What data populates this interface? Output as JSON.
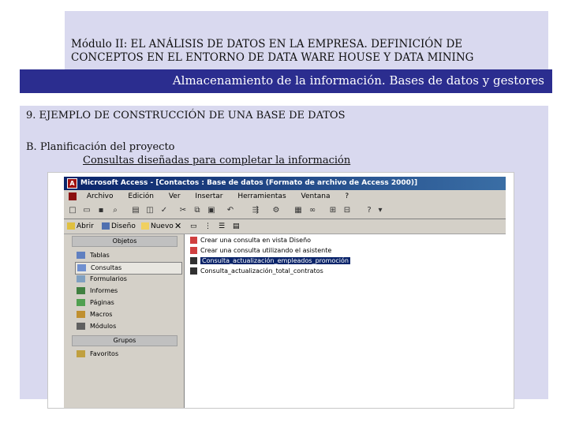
{
  "slide": {
    "header_line1": "Módulo II: EL ANÁLISIS DE DATOS EN LA EMPRESA. DEFINICIÓN DE",
    "header_line2": "CONCEPTOS EN EL ENTORNO DE DATA WARE HOUSE Y DATA MINING",
    "banner": "Almacenamiento de la información. Bases de datos y gestores",
    "section_title": "9. EJEMPLO DE CONSTRUCCIÓN DE UNA BASE DE DATOS",
    "sub_title": "B. Planificación del proyecto",
    "sub_sub_title": "Consultas diseñadas para completar la información",
    "colors": {
      "header_bg": "#d9d9ef",
      "banner_bg": "#2b2d8f",
      "banner_text": "#ffffff"
    }
  },
  "access": {
    "title": "Microsoft Access - [Contactos : Base de datos (Formato de archivo de Access 2000)]",
    "menu": [
      "Archivo",
      "Edición",
      "Ver",
      "Insertar",
      "Herramientas",
      "Ventana",
      "?"
    ],
    "db_toolbar": {
      "open": "Abrir",
      "design": "Diseño",
      "new": "Nuevo"
    },
    "objects_header": "Objetos",
    "objects": [
      {
        "label": "Tablas",
        "icon": "table-icon"
      },
      {
        "label": "Consultas",
        "icon": "query-icon",
        "selected": true
      },
      {
        "label": "Formularios",
        "icon": "form-icon"
      },
      {
        "label": "Informes",
        "icon": "report-icon"
      },
      {
        "label": "Páginas",
        "icon": "page-icon"
      },
      {
        "label": "Macros",
        "icon": "macro-icon"
      },
      {
        "label": "Módulos",
        "icon": "module-icon"
      }
    ],
    "groups_header": "Grupos",
    "groups": [
      {
        "label": "Favoritos",
        "icon": "favorites-icon"
      }
    ],
    "queries": [
      {
        "label": "Crear una consulta en vista Diseño",
        "icon": "wizard-icon"
      },
      {
        "label": "Crear una consulta utilizando el asistente",
        "icon": "wizard-icon"
      },
      {
        "label": "Consulta_actualización_empleados_promoción",
        "icon": "update-query-icon",
        "selected": true
      },
      {
        "label": "Consulta_actualización_total_contratos",
        "icon": "update-query-icon"
      }
    ]
  }
}
